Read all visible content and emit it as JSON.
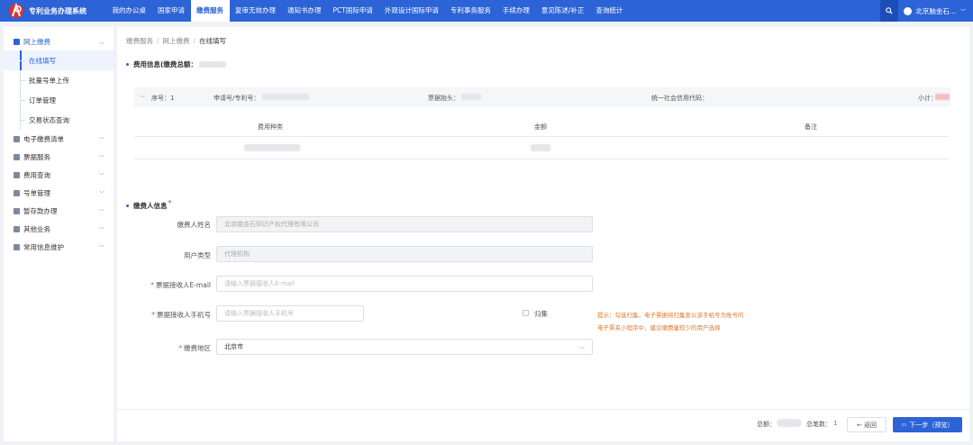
{
  "header": {
    "app_title": "专利业务办理系统",
    "nav": [
      "我的办公桌",
      "国家申请",
      "缴费服务",
      "复审无效办理",
      "通知书办理",
      "PCT国际申请",
      "外观设计国际申请",
      "专利事务服务",
      "手续办理",
      "意见陈述/补正",
      "查询统计"
    ],
    "active_nav": "缴费服务",
    "user_name": "北京脑金石..."
  },
  "sidebar": {
    "group_open": "网上缴费",
    "sub_items": [
      "在线填写",
      "批量号单上传",
      "订单管理",
      "交易状态查询"
    ],
    "active_sub": "在线填写",
    "groups": [
      "电子缴费清单",
      "票据服务",
      "费用查询",
      "号单管理",
      "暂存款办理",
      "其他业务",
      "常用信息维护"
    ]
  },
  "breadcrumb": [
    "缴费服务",
    "网上缴费",
    "在线填写"
  ],
  "fee_info": {
    "title": "费用信息(缴费总额：",
    "row": {
      "seq_label": "序号：1",
      "app_no_label": "申请号/专利号：",
      "invoice_label": "票据抬头：",
      "credit_code_label": "统一社会信用代码：",
      "subtotal_label": "小计："
    },
    "table_headers": [
      "费用种类",
      "金额",
      "备注"
    ]
  },
  "payer_info": {
    "title": "缴费人信息",
    "name_label": "缴费人姓名",
    "name_value": "北京脑金石知识产权代理有限公司",
    "user_type_label": "用户类型",
    "user_type_value": "代理机构",
    "email_label": "票据接收人E-mail",
    "email_placeholder": "请输入票据接收人E-mail",
    "phone_label": "票据接收人手机号",
    "phone_placeholder": "请输入票据接收人手机号",
    "merge_label": "归集",
    "hint_line1": "提示：勾选归集，电子票据将归集至以该手机号为账号的",
    "hint_line2": "电子票夹小程序中，建议缴费量较少的用户选择",
    "region_label": "缴费地区",
    "region_value": "北京市"
  },
  "footer": {
    "total_label": "总额：",
    "count_label": "总笔数：",
    "count_value": "1",
    "back_label": "← 返回",
    "next_label": "下一步（预览）"
  },
  "colors": {
    "primary": "#2c63d6",
    "warning": "#e0782a",
    "required": "#e04a4a"
  }
}
